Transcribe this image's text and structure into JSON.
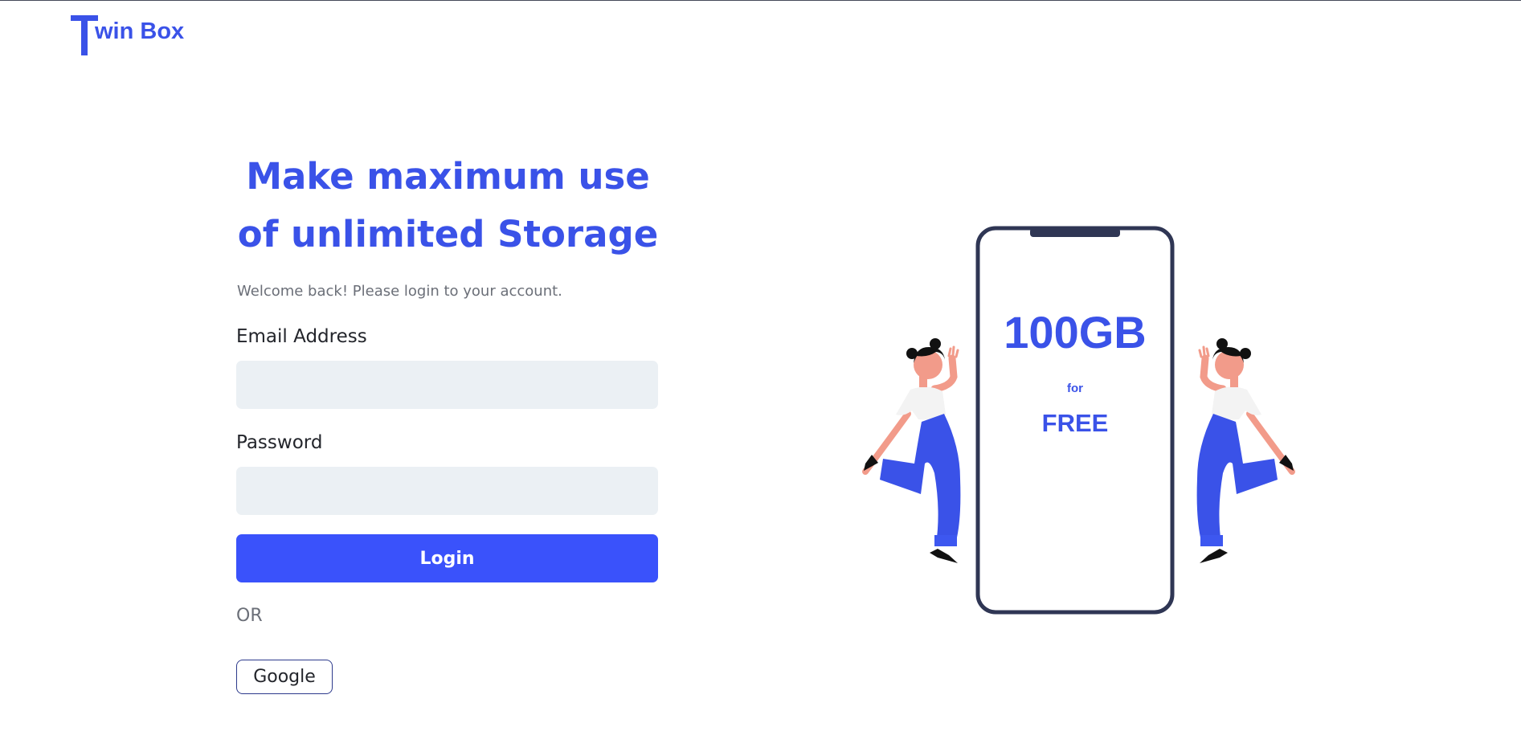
{
  "brand": {
    "logo_letter": "T",
    "logo_rest": "win Box",
    "color": "#3a52e8"
  },
  "hero": {
    "headline": "Make maximum use of unlimited Storage",
    "welcome": "Welcome back! Please login to your account."
  },
  "form": {
    "email_label": "Email Address",
    "email_value": "",
    "email_placeholder": "",
    "password_label": "Password",
    "password_value": "",
    "password_placeholder": "",
    "login_label": "Login",
    "or_text": "OR",
    "google_label": "Google",
    "accent_color": "#3a52fb",
    "input_bg_color": "#ebf0f4"
  },
  "promo": {
    "amount": "100GB",
    "connector": "for",
    "price": "FREE",
    "icons": [
      "phone-illustration",
      "dancing-woman-illustration"
    ]
  }
}
